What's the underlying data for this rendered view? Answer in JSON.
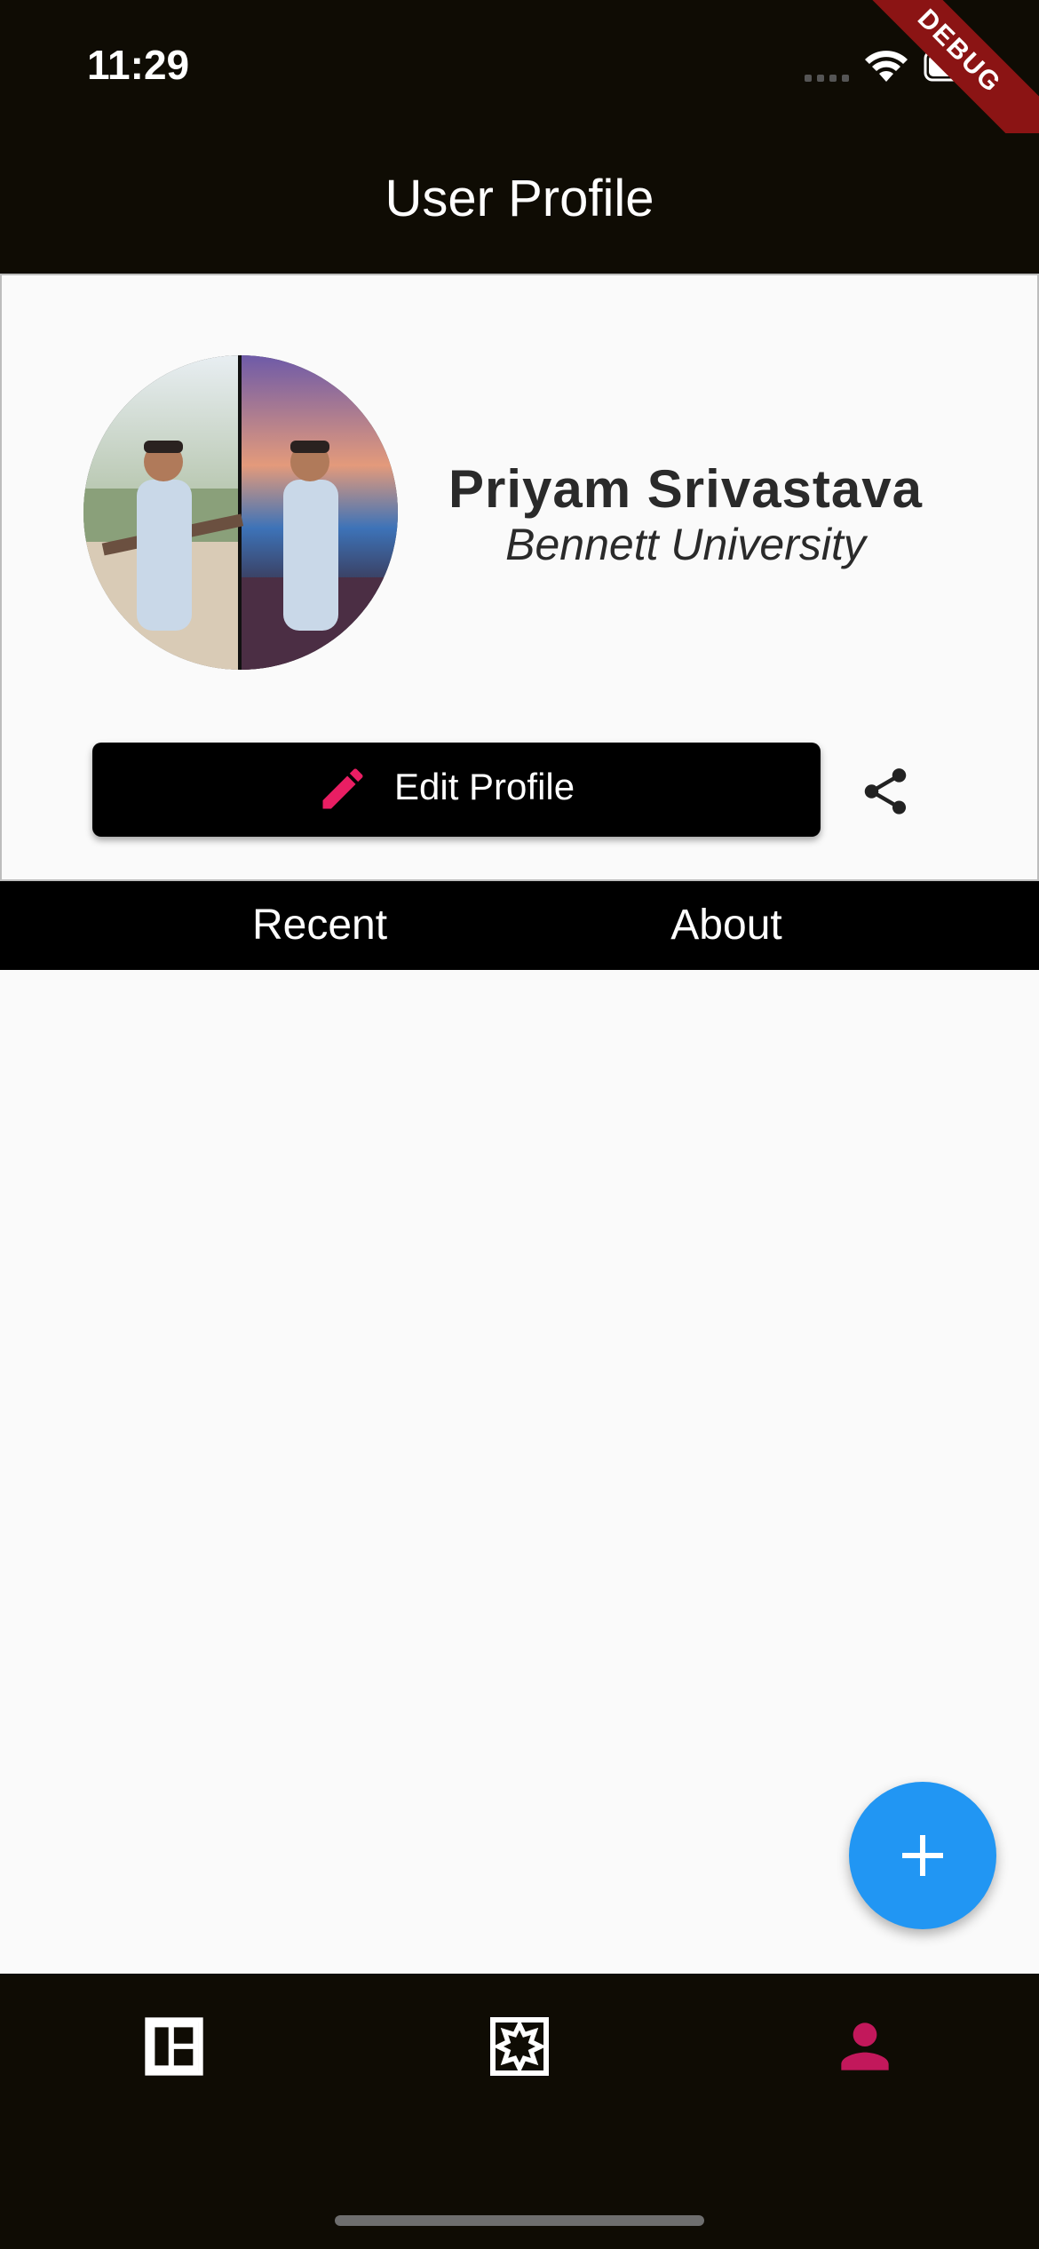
{
  "status_bar": {
    "time": "11:29",
    "debug_label": "DEBUG"
  },
  "app_bar": {
    "title": "User Profile"
  },
  "profile": {
    "name": "Priyam Srivastava",
    "organization": "Bennett University",
    "edit_button_label": "Edit Profile",
    "edit_icon_color": "#e91e63"
  },
  "tabs": [
    {
      "label": "Recent"
    },
    {
      "label": "About"
    }
  ],
  "fab": {
    "icon": "plus-icon",
    "color": "#2196f3"
  },
  "bottom_nav": {
    "items": [
      {
        "icon": "dashboard-icon",
        "active": false
      },
      {
        "icon": "explore-icon",
        "active": false
      },
      {
        "icon": "person-icon",
        "active": true
      }
    ],
    "active_color": "#c2185b",
    "inactive_color": "#ffffff"
  }
}
